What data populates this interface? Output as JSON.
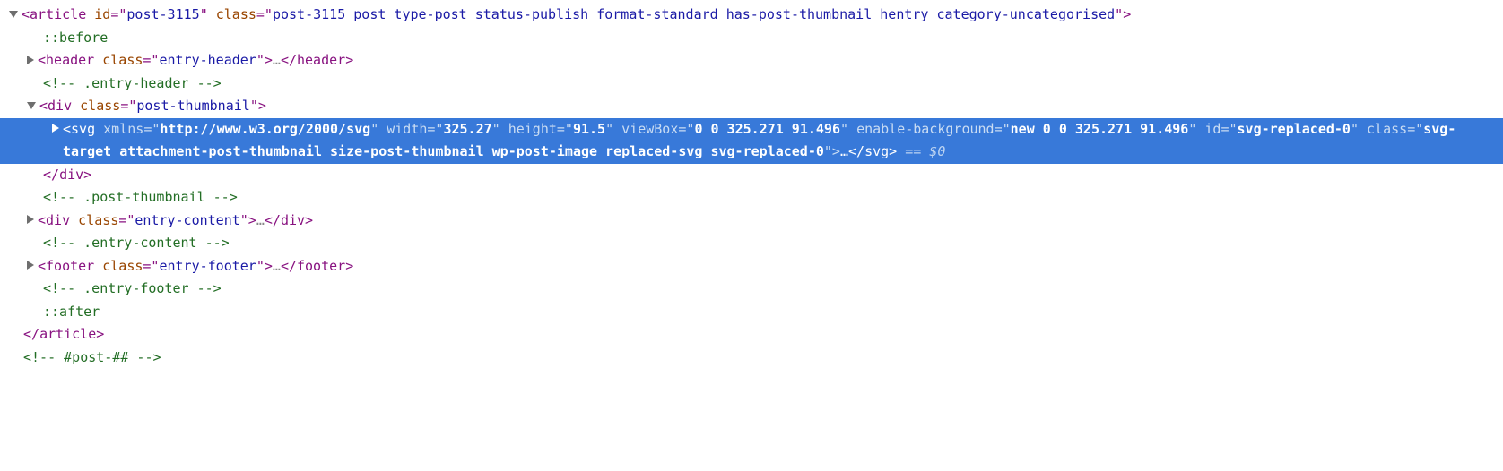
{
  "pseudo_before": "::before",
  "pseudo_after": "::after",
  "ellipsis": "…",
  "eqzero": " == $0",
  "article": {
    "tag": "article",
    "id_attr": "id",
    "id_val": "post-3115",
    "class_attr": "class",
    "class_val": "post-3115 post type-post status-publish format-standard has-post-thumbnail hentry category-uncategorised"
  },
  "header": {
    "tag": "header",
    "class_attr": "class",
    "class_val": "entry-header",
    "comment": "<!-- .entry-header -->"
  },
  "thumb_div": {
    "tag": "div",
    "class_attr": "class",
    "class_val": "post-thumbnail",
    "comment": "<!-- .post-thumbnail -->"
  },
  "svg": {
    "tag": "svg",
    "xmlns_name": "xmlns",
    "xmlns_val": "http://www.w3.org/2000/svg",
    "width_name": "width",
    "width_val": "325.27",
    "height_name": "height",
    "height_val": "91.5",
    "viewbox_name": "viewBox",
    "viewbox_val": "0 0 325.271 91.496",
    "ebg_name": "enable-background",
    "ebg_val": "new 0 0 325.271 91.496",
    "id_name": "id",
    "id_val": "svg-replaced-0",
    "class_name": "class",
    "class_val": "svg-target attachment-post-thumbnail size-post-thumbnail wp-post-image replaced-svg svg-replaced-0"
  },
  "content_div": {
    "tag": "div",
    "class_attr": "class",
    "class_val": "entry-content",
    "comment": "<!-- .entry-content -->"
  },
  "footer": {
    "tag": "footer",
    "class_attr": "class",
    "class_val": "entry-footer",
    "comment": "<!-- .entry-footer -->"
  },
  "article_close": "article",
  "post_comment": "<!-- #post-## -->"
}
